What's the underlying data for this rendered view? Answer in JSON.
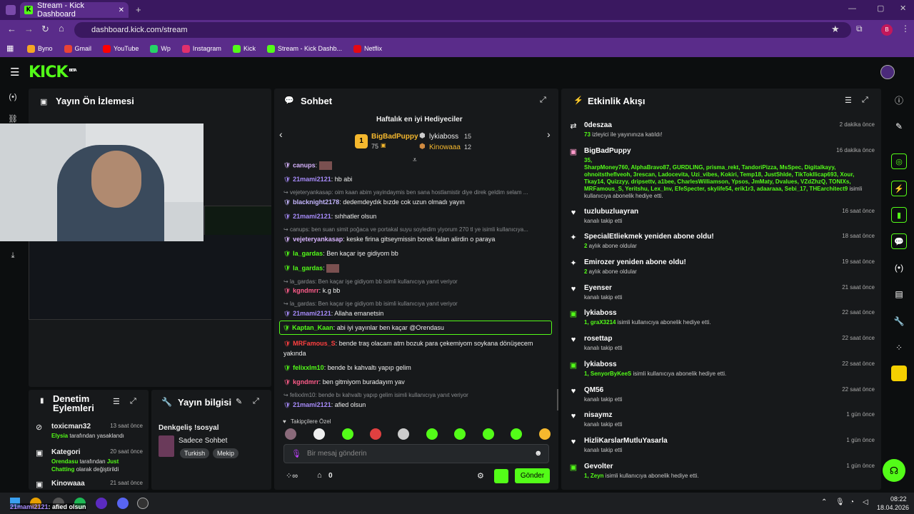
{
  "browser": {
    "tab_title": "Stream - Kick Dashboard",
    "url": "dashboard.kick.com/stream",
    "profile_initial": "B",
    "bookmarks": [
      {
        "label": "Byno",
        "color": "#f5a623"
      },
      {
        "label": "Gmail",
        "color": "#ea4335"
      },
      {
        "label": "YouTube",
        "color": "#ff0000"
      },
      {
        "label": "Wp",
        "color": "#25d366"
      },
      {
        "label": "Instagram",
        "color": "#e1306c"
      },
      {
        "label": "Kick",
        "color": "#53fc18"
      },
      {
        "label": "Stream - Kick Dashb...",
        "color": "#53fc18"
      },
      {
        "label": "Netflix",
        "color": "#e50914"
      }
    ]
  },
  "kick": {
    "logo": "KICK",
    "beta": "BETA"
  },
  "preview": {
    "title": "Yayın Ön İzlemesi"
  },
  "mod": {
    "title_line1": "Denetim",
    "title_line2": "Eylemleri",
    "items": [
      {
        "name": "toxicman32",
        "time": "13 saat önce",
        "parts": [
          {
            "t": "Elysia",
            "g": true
          },
          {
            "t": " tarafından yasaklandı",
            "g": false
          }
        ]
      },
      {
        "name": "Kategori",
        "time": "20 saat önce",
        "parts": [
          {
            "t": "Orendasu",
            "g": true
          },
          {
            "t": " tarafından ",
            "g": false
          },
          {
            "t": "Just Chatting",
            "g": true
          },
          {
            "t": " olarak değiştirildi",
            "g": false
          }
        ]
      },
      {
        "name": "Kinowaaa",
        "time": "21 saat önce",
        "parts": []
      }
    ]
  },
  "info": {
    "title": "Yayın bilgisi",
    "stream_title": "Denkgeliş !sosyal",
    "category": "Sadece Sohbet",
    "tags": [
      "Turkish",
      "Mekip"
    ]
  },
  "chat": {
    "title": "Sohbet",
    "gifters_title": "Haftalık en iyi Hediyeciler",
    "top": {
      "rank": "1",
      "name": "BigBadPuppy",
      "count": "75"
    },
    "second": {
      "name": "lykiaboss",
      "count": "15"
    },
    "third": {
      "name": "Kinowaaa",
      "count": "12"
    },
    "lines": [
      {
        "type": "msg",
        "user": "canups",
        "color": "#d8b4ff",
        "text": ""
      },
      {
        "type": "msg",
        "user": "21mami2121",
        "color": "#a78bfa",
        "text": "hb abi"
      },
      {
        "type": "reply",
        "text": "vejeteryankasap: oim kaan abim yayindaymis ben sana hostlamistir diye direk geldim selam ..."
      },
      {
        "type": "msg",
        "user": "blacknight2178",
        "color": "#c4b5fd",
        "text": "dedemdeydık bızde cok uzun olmadı yayın"
      },
      {
        "type": "msg",
        "user": "21mami2121",
        "color": "#a78bfa",
        "text": "sıhhatler olsun"
      },
      {
        "type": "reply",
        "text": "canups: ben suan simit poğaca ve portakal suyu soyledim yiyorum 270 tl ye isimli kullanıcıya..."
      },
      {
        "type": "msg",
        "user": "vejeteryankasap",
        "color": "#d8b4ff",
        "text": "keske firina gitseymissin borek falan alirdin o paraya"
      },
      {
        "type": "msg",
        "user": "la_gardas",
        "color": "#53fc18",
        "text": "Ben kaçar işe gidiyom bb"
      },
      {
        "type": "msg",
        "user": "la_gardas",
        "color": "#53fc18",
        "text": ""
      },
      {
        "type": "reply",
        "text": "la_gardas: Ben kaçar işe gidiyom bb isimli kullanıcıya yanıt veriyor"
      },
      {
        "type": "msg",
        "user": "kgndmrr",
        "color": "#ff5c8a",
        "text": "k.g bb"
      },
      {
        "type": "reply",
        "text": "la_gardas: Ben kaçar işe gidiyom bb isimli kullanıcıya yanıt veriyor"
      },
      {
        "type": "msg",
        "user": "21mami2121",
        "color": "#a78bfa",
        "text": "Allaha emanetsin"
      },
      {
        "type": "highlight",
        "user": "Kaptan_Kaan",
        "color": "#53fc18",
        "text": "abi iyi yayınlar ben kaçar @Orendasu"
      },
      {
        "type": "msg",
        "user": "MRFamous_S",
        "color": "#ff4040",
        "text": "bende traş olacam atm bozuk para çekemiyom soykana dönüşecem"
      },
      {
        "type": "cont",
        "text": "yakında"
      },
      {
        "type": "msg",
        "user": "felixxlm10",
        "color": "#53fc18",
        "text": "bende bı kahvaltı yapıp gelim"
      },
      {
        "type": "msg",
        "user": "kgndmrr",
        "color": "#ff5c8a",
        "text": "ben gitmiyom buradayım yav"
      },
      {
        "type": "reply",
        "text": "felixxlm10: bende bı kahvaltı yapıp gelim isimli kullanıcıya yanıt veriyor"
      },
      {
        "type": "msg",
        "user": "21mami2121",
        "color": "#a78bfa",
        "text": "afied olsun"
      }
    ],
    "followers_only": "Takipçilere Özel",
    "placeholder": "Bir mesaj gönderin",
    "points": "0",
    "send": "Gönder"
  },
  "activity": {
    "title": "Etkinlik Akışı",
    "items": [
      {
        "icon": "raid",
        "name": "0deszaa",
        "time": "2 dakika önce",
        "sub_g": "73",
        "sub": " izleyici ile yayınınıza katıldı!"
      },
      {
        "icon": "gift",
        "name": "BigBadPuppy",
        "time": "16 dakika önce",
        "count": "35,",
        "names": "SharpMoney760, AlphaBravo87, GURDLING, prisma_rekt, TandoriPizza, MsSpec, Digitalkayy, ohnoitstheflveoh, 3rescan, Ladocevita, Uzi_vibes, Kokiri, Temp18, JustShlde, TikTokIlicap693, Xour, Tkay14, Quizzyy, dripsettv, a1bee, CharlesWilliamson, Ypsos, JmMaty, Dvalues, VZdZhzQ, TONIXs, MRFamous_S, Yeritshu, Lex_Inv, EfeSpecter, skylife54, erik1r3, adaaraaa, Sebi_17, THEarchitect9",
        "tail": "isimli kullanıcıya abonelik hediye etti."
      },
      {
        "icon": "heart",
        "name": "tuzlubuzluayran",
        "time": "16 saat önce",
        "sub": "kanalı takip etti"
      },
      {
        "icon": "star",
        "name": "SpecialEtliekmek yeniden abone oldu!",
        "time": "18 saat önce",
        "sub_g": "2",
        "sub": " aylık abone oldular"
      },
      {
        "icon": "star",
        "name": "Emirozer yeniden abone oldu!",
        "time": "19 saat önce",
        "sub_g": "2",
        "sub": " aylık abone oldular"
      },
      {
        "icon": "heart",
        "name": "Eyenser",
        "time": "21 saat önce",
        "sub": "kanalı takip etti"
      },
      {
        "icon": "gift",
        "name": "lykiaboss",
        "time": "22 saat önce",
        "sub_g": "1, graX3214",
        "sub": " isimli kullanıcıya abonelik hediye etti."
      },
      {
        "icon": "heart",
        "name": "rosettap",
        "time": "22 saat önce",
        "sub": "kanalı takip etti"
      },
      {
        "icon": "gift",
        "name": "lykiaboss",
        "time": "22 saat önce",
        "sub_g": "1, SenyorByKeeS",
        "sub": " isimli kullanıcıya abonelik hediye etti."
      },
      {
        "icon": "heart",
        "name": "QM56",
        "time": "22 saat önce",
        "sub": "kanalı takip etti"
      },
      {
        "icon": "heart",
        "name": "nisaymz",
        "time": "1 gün önce",
        "sub": "kanalı takip etti"
      },
      {
        "icon": "heart",
        "name": "HizliKarslarMutluYasarla",
        "time": "1 gün önce",
        "sub": "kanalı takip etti"
      },
      {
        "icon": "gift",
        "name": "Gevolter",
        "time": "1 gün önce",
        "sub_g": "1, Zeyn",
        "sub": " isimli kullanıcıya abonelik hediye etti."
      }
    ]
  },
  "taskbar": {
    "overlay_user": "21mami2121",
    "overlay_text": ": afied olsun",
    "time": "08:22",
    "date": "18.04.2026"
  }
}
